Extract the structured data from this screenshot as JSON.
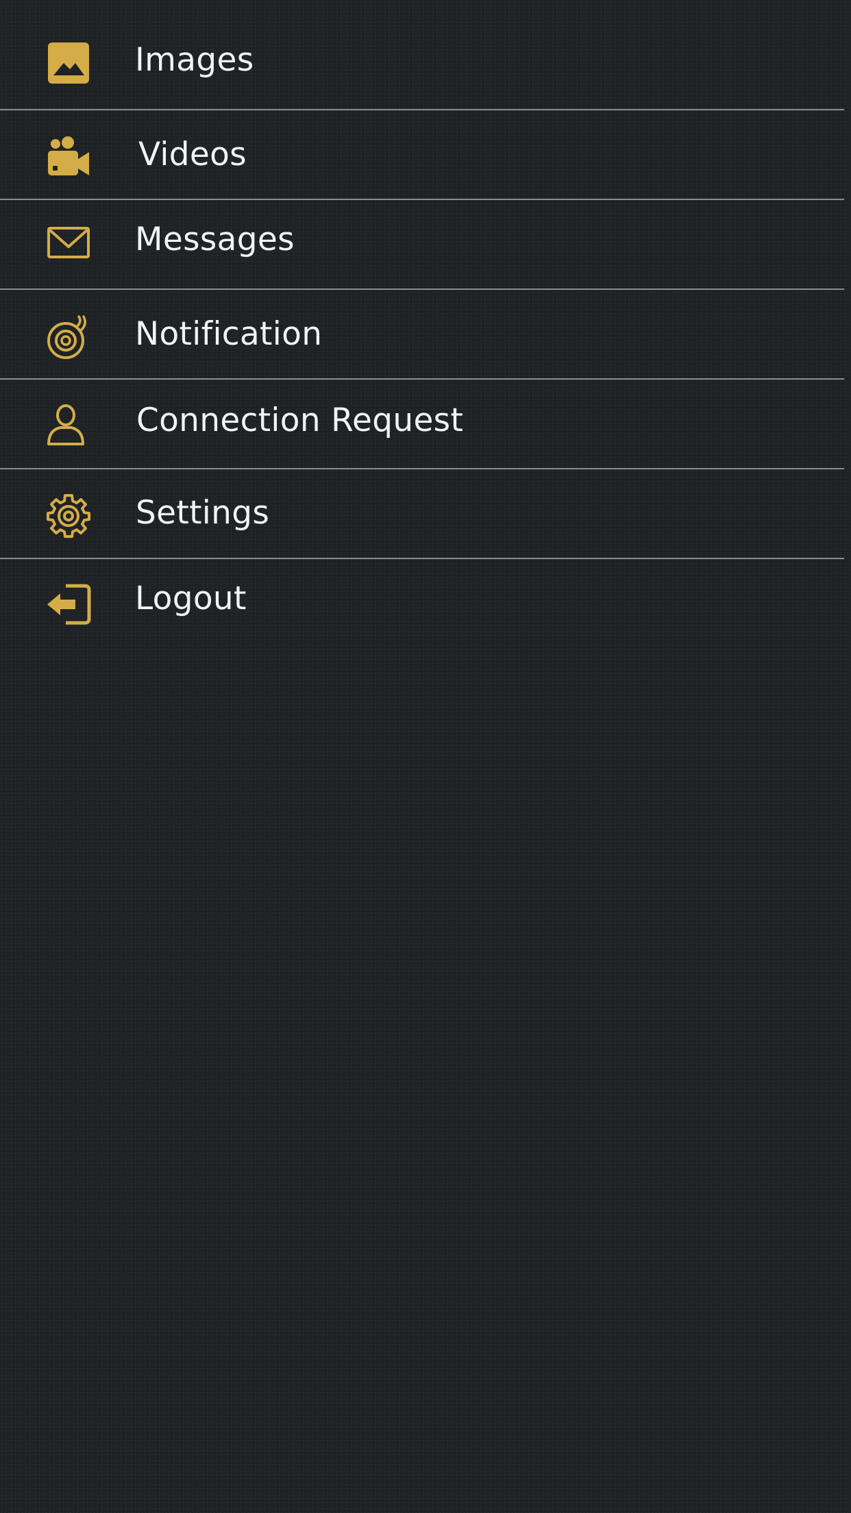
{
  "accent_color": "#d4ad48",
  "menu": {
    "items": [
      {
        "label": "Images",
        "icon": "image-icon"
      },
      {
        "label": "Videos",
        "icon": "video-camera-icon"
      },
      {
        "label": "Messages",
        "icon": "envelope-icon"
      },
      {
        "label": "Notification",
        "icon": "bell-icon"
      },
      {
        "label": "Connection Request",
        "icon": "user-icon"
      },
      {
        "label": "Settings",
        "icon": "gear-icon"
      },
      {
        "label": "Logout",
        "icon": "logout-icon"
      }
    ]
  }
}
